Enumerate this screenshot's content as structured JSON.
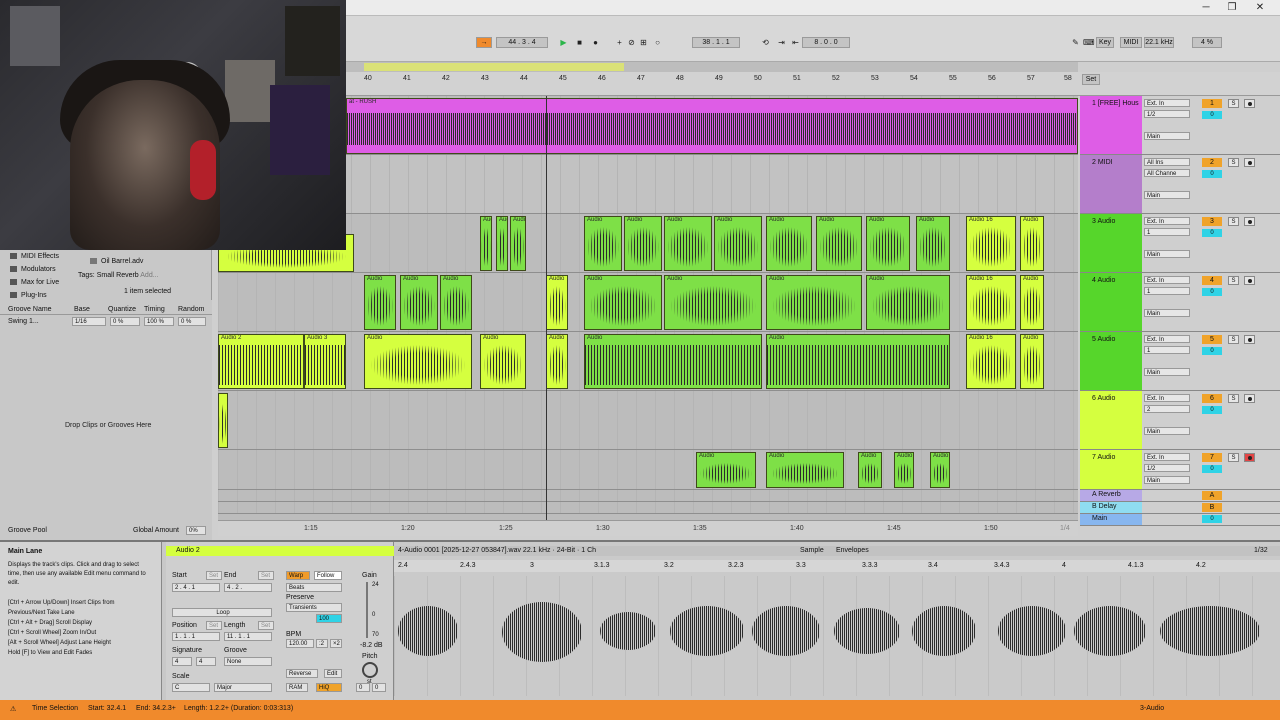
{
  "window": {
    "minimize": "─",
    "restore": "❐",
    "close": "✕"
  },
  "transport": {
    "position": "44 . 3 . 4",
    "loop_start": "38 . 1 . 1",
    "loop_length": "8 . 0 . 0",
    "key_label": "Key",
    "midi_label": "MIDI",
    "sample_rate": "22.1 kHz",
    "cpu": "4 %"
  },
  "ruler": {
    "bars": [
      "40",
      "41",
      "42",
      "43",
      "44",
      "45",
      "46",
      "47",
      "48",
      "49",
      "50",
      "51",
      "52",
      "53",
      "54",
      "55",
      "56",
      "57",
      "58"
    ],
    "set_label": "Set"
  },
  "browser": {
    "items": [
      "MIDI Effects",
      "Modulators",
      "Max for Live",
      "Plug-Ins"
    ],
    "preset": "Oil Barrel.adv",
    "tags_label": "Tags:",
    "tag_value": "Small Reverb",
    "tag_add": "Add...",
    "selection": "1 item selected"
  },
  "groove": {
    "headers": [
      "Groove Name",
      "Base",
      "Quantize",
      "Timing",
      "Random"
    ],
    "row": {
      "name": "Swing 1...",
      "base": "1/16",
      "quantize": "0 %",
      "timing": "100 %",
      "random": "0 %"
    },
    "drop_hint": "Drop Clips or Grooves Here",
    "footer": "Groove Pool",
    "global_amount_label": "Global Amount",
    "global_amount": "0%"
  },
  "tracks": [
    {
      "name": "1 [FREE] Hous",
      "input": "Ext. In",
      "channel": "1/2",
      "output": "Main",
      "num": "1",
      "color": "#de5de6"
    },
    {
      "name": "2 MIDI",
      "input": "All Ins",
      "channel": "All Channe",
      "output": "Main",
      "num": "2",
      "color": "#b47ecb"
    },
    {
      "name": "3 Audio",
      "input": "Ext. In",
      "channel": "1",
      "output": "Main",
      "num": "3",
      "color": "#56d62b"
    },
    {
      "name": "4 Audio",
      "input": "Ext. In",
      "channel": "1",
      "output": "Main",
      "num": "4",
      "color": "#56d62b"
    },
    {
      "name": "5 Audio",
      "input": "Ext. In",
      "channel": "1",
      "output": "Main",
      "num": "5",
      "color": "#56d62b"
    },
    {
      "name": "6 Audio",
      "input": "Ext. In",
      "channel": "2",
      "output": "Main",
      "num": "6",
      "color": "#d5ff3f"
    },
    {
      "name": "7 Audio",
      "input": "Ext. In",
      "channel": "1/2",
      "output": "Main",
      "num": "7",
      "color": "#d5ff3f"
    },
    {
      "name": "A Reverb",
      "num": "A",
      "color": "#b7a9e6"
    },
    {
      "name": "B Delay",
      "num": "B",
      "color": "#8fdcf0"
    },
    {
      "name": "Main",
      "num": "0",
      "color": "#87b6ef"
    }
  ],
  "clip_labels": {
    "rush": "at - RUSH",
    "audio": "Audio",
    "audio2": "Audio 2",
    "audio3": "Audio 3",
    "audio16": "Audio 16"
  },
  "time_ruler": [
    "1:15",
    "1:20",
    "1:25",
    "1:30",
    "1:35",
    "1:40",
    "1:45",
    "1:50"
  ],
  "time_ruler_right": "1/4",
  "info": {
    "title": "Main Lane",
    "text": "Displays the track's clips. Click and drag to select time, then use any available Edit menu command to edit.",
    "shortcuts": "[Ctrl + Arrow Up/Down] Insert Clips from Previous/Next Take Lane\n[Ctrl + Alt + Drag] Scroll Display\n[Ctrl + Scroll Wheel] Zoom In/Out\n[Alt + Scroll Wheel] Adjust Lane Height\nHold [F] to View and Edit Fades"
  },
  "clip": {
    "name": "Audio 2",
    "start_label": "Start",
    "end_label": "End",
    "start": "2 . 4 . 1",
    "end": "4 . 2 .",
    "set": "Set",
    "loop": "Loop",
    "position_label": "Position",
    "length_label": "Length",
    "position": "1 . 1 . 1",
    "length": "11 . 1 . 1",
    "signature_label": "Signature",
    "sig_num": "4",
    "sig_den": "4",
    "groove_label": "Groove",
    "groove_value": "None",
    "scale_label": "Scale",
    "scale_root": "C",
    "scale_mode": "Major",
    "warp": "Warp",
    "follow": "Follow",
    "warp_mode": "Beats",
    "preserve_label": "Preserve",
    "preserve": "Transients",
    "warp_amount": "100",
    "bpm_label": "BPM",
    "bpm": "120.00",
    "half": ":2",
    "double": "×2",
    "gain_label": "Gain",
    "gain": "-8.2 dB",
    "gain_top": "24",
    "gain_mid": "0",
    "gain_bot": "70",
    "pitch_label": "Pitch",
    "pitch_unit": "st",
    "pitch_a": "0",
    "pitch_b": "0",
    "reverse": "Reverse",
    "edit": "Edit",
    "ram": "RAM",
    "hiq": "HiQ"
  },
  "sample": {
    "file": "4-Audio 0001 [2025-12-27 053847].wav  22.1 kHz · 24-Bit · 1 Ch",
    "tab_sample": "Sample",
    "tab_envelopes": "Envelopes",
    "grid": "1/32",
    "markers": [
      "2.4",
      "2.4.3",
      "3",
      "3.1.3",
      "3.2",
      "3.2.3",
      "3.3",
      "3.3.3",
      "3.4",
      "3.4.3",
      "4",
      "4.1.3",
      "4.2"
    ]
  },
  "status": {
    "mode": "Time Selection",
    "start": "Start: 32.4.1",
    "end": "End: 34.2.3+",
    "length": "Length: 1.2.2+ (Duration: 0:03:313)",
    "track": "3-Audio"
  },
  "colors": {
    "accent": "#f08a2c",
    "lime": "#d5ff3f",
    "green": "#7ee047",
    "magenta": "#de5de6",
    "cyan": "#2fd3e6"
  }
}
